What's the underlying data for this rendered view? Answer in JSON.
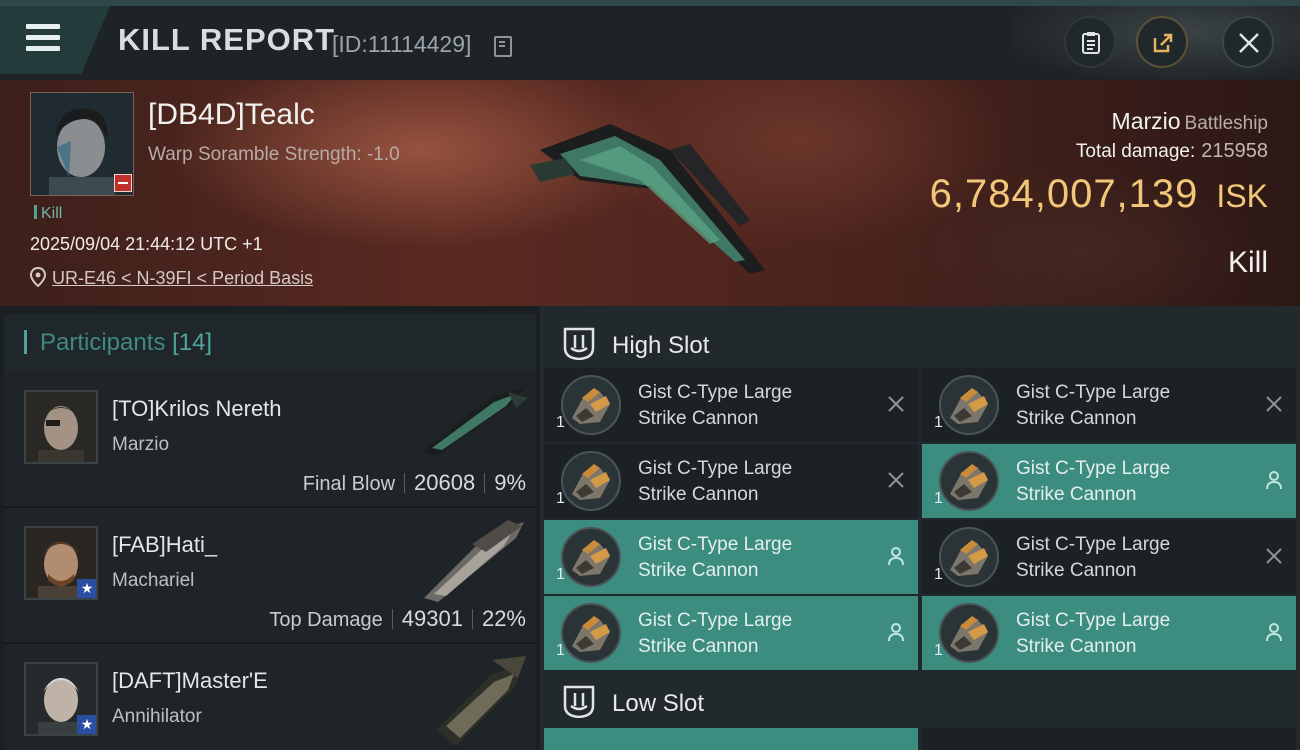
{
  "header": {
    "title": "KILL REPORT",
    "report_id": "[ID:11114429]",
    "icons": [
      "menu-icon",
      "copy-icon",
      "clipboard-icon",
      "share-icon",
      "close-icon"
    ]
  },
  "victim": {
    "name": "[DB4D]Tealc",
    "subtitle": "Warp Soramble Strength: -1.0",
    "tag": "Kill",
    "datetime": "2025/09/04 21:44:12 UTC +1",
    "location": "UR-E46 < N-39FI < Period Basis",
    "ship_name": "Marzio",
    "ship_class": "Battleship",
    "total_damage_label": "Total damage:",
    "total_damage": "215958",
    "isk_value": "6,784,007,139",
    "isk_unit": "ISK",
    "result": "Kill"
  },
  "participants": {
    "label": "Participants",
    "count": "[14]",
    "rows": [
      {
        "name": "[TO]Krilos Nereth",
        "ship": "Marzio",
        "role": "Final Blow",
        "damage": "20608",
        "percent": "9%"
      },
      {
        "name": "[FAB]Hati_",
        "ship": "Machariel",
        "role": "Top Damage",
        "damage": "49301",
        "percent": "22%"
      },
      {
        "name": "[DAFT]Master'E",
        "ship": "Annihilator",
        "role": "",
        "damage": "",
        "percent": ""
      }
    ]
  },
  "slots": {
    "high_label": "High Slot",
    "low_label": "Low Slot",
    "high_modules": [
      {
        "line1": "Gist C-Type Large",
        "line2": "Strike Cannon",
        "qty": "1",
        "status": "destroyed"
      },
      {
        "line1": "Gist C-Type Large",
        "line2": "Strike Cannon",
        "qty": "1",
        "status": "destroyed"
      },
      {
        "line1": "Gist C-Type Large",
        "line2": "Strike Cannon",
        "qty": "1",
        "status": "destroyed"
      },
      {
        "line1": "Gist C-Type Large",
        "line2": "Strike Cannon",
        "qty": "1",
        "status": "dropped"
      },
      {
        "line1": "Gist C-Type Large",
        "line2": "Strike Cannon",
        "qty": "1",
        "status": "dropped"
      },
      {
        "line1": "Gist C-Type Large",
        "line2": "Strike Cannon",
        "qty": "1",
        "status": "destroyed"
      },
      {
        "line1": "Gist C-Type Large",
        "line2": "Strike Cannon",
        "qty": "1",
        "status": "dropped"
      },
      {
        "line1": "Gist C-Type Large",
        "line2": "Strike Cannon",
        "qty": "1",
        "status": "dropped"
      }
    ]
  },
  "colors": {
    "accent": "#4ea39a",
    "isk": "#f2c878",
    "dropped": "#3d8c80",
    "destroyed": "#1b2124"
  }
}
